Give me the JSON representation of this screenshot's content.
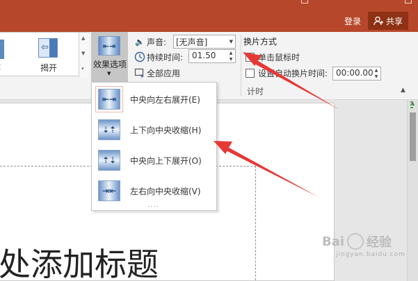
{
  "account": {
    "signin_label": "登录",
    "share_label": "共享"
  },
  "gallery": {
    "left_partial_label": "t",
    "push_label": "揭开"
  },
  "effect_options": {
    "label": "效果选项"
  },
  "timing": {
    "sound_label": "声音:",
    "sound_value": "[无声音]",
    "duration_label": "持续时间:",
    "duration_value": "01.50",
    "apply_all_label": "全部应用"
  },
  "advance": {
    "title": "换片方式",
    "on_click_label": "单击鼠标时",
    "after_time_label": "设置自动换片时间:",
    "after_time_value": "00:00.00",
    "group_label": "计时"
  },
  "effect_menu": {
    "items": [
      {
        "label": "中央向左右展开(E)",
        "icon": "split-horizontal-out-icon",
        "selected": true
      },
      {
        "label": "上下向中央收缩(H)",
        "icon": "split-vertical-in-icon",
        "selected": false
      },
      {
        "label": "中央向上下展开(O)",
        "icon": "split-vertical-out-icon",
        "selected": false
      },
      {
        "label": "左右向中央收缩(V)",
        "icon": "split-horizontal-in-icon",
        "selected": false
      }
    ]
  },
  "slide": {
    "title_text": "处添加标题"
  },
  "watermark": {
    "text": "Bai",
    "text2": "经验",
    "sub": "jingyan.baidu.com"
  },
  "colors": {
    "accent": "#b7472a",
    "share_bg": "#8f3115",
    "arrow": "#e53935"
  }
}
